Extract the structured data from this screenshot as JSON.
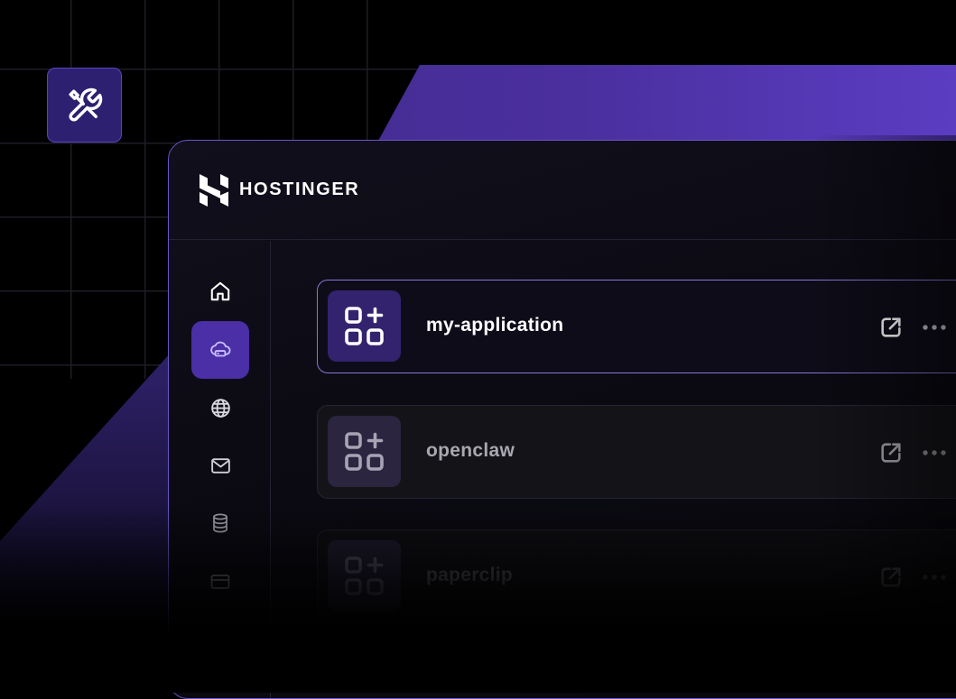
{
  "brand": {
    "name": "HOSTINGER",
    "logo_icon": "hostinger-logo-icon"
  },
  "badge": {
    "icon": "tools-icon"
  },
  "sidebar": {
    "items": [
      {
        "icon": "home-icon",
        "active": false
      },
      {
        "icon": "cloud-server-icon",
        "active": true
      },
      {
        "icon": "globe-icon",
        "active": false
      },
      {
        "icon": "mail-icon",
        "active": false
      },
      {
        "icon": "database-icon",
        "active": false
      },
      {
        "icon": "credit-card-icon",
        "active": false
      }
    ]
  },
  "apps": [
    {
      "name": "my-application",
      "icon": "apps-add-icon"
    },
    {
      "name": "openclaw",
      "icon": "apps-add-icon"
    },
    {
      "name": "paperclip",
      "icon": "apps-add-icon"
    }
  ],
  "colors": {
    "accent": "#4a2fa6",
    "border_highlight": "#8876d6",
    "background": "#000000"
  }
}
